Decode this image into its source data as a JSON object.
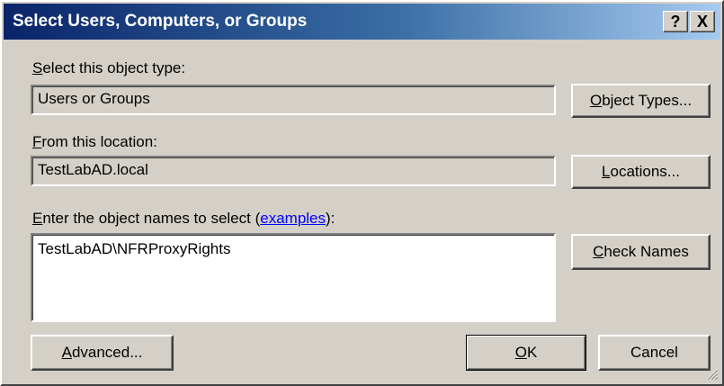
{
  "dialog": {
    "title": "Select Users, Computers, or Groups",
    "help_glyph": "?",
    "close_glyph": "X"
  },
  "object_type": {
    "label_hotkey": "S",
    "label_rest": "elect this object type:",
    "value": "Users or Groups",
    "button_hotkey": "O",
    "button_rest": "bject Types..."
  },
  "location": {
    "label_hotkey": "F",
    "label_rest": "rom this location:",
    "value": "TestLabAD.local",
    "button_hotkey": "L",
    "button_rest": "ocations..."
  },
  "names": {
    "label_hotkey": "E",
    "label_rest": "nter the object names to select (",
    "link_text": "examples",
    "label_suffix": "):",
    "value": "TestLabAD\\NFRProxyRights",
    "button_hotkey": "C",
    "button_rest": "heck Names"
  },
  "footer": {
    "advanced_hotkey": "A",
    "advanced_rest": "dvanced...",
    "ok_hotkey": "O",
    "ok_rest": "K",
    "cancel_label": "Cancel"
  }
}
